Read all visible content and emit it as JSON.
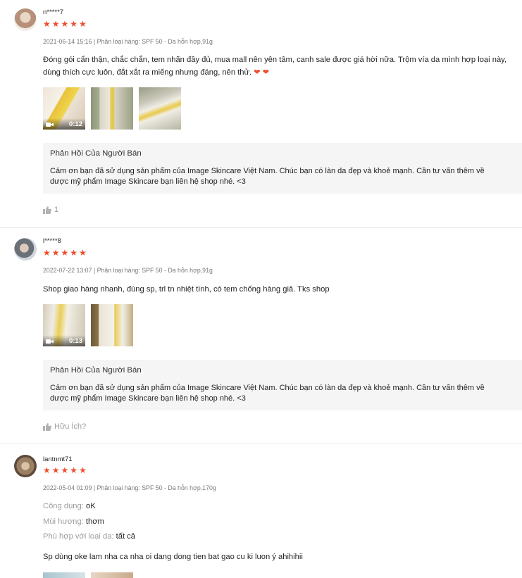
{
  "reviews": [
    {
      "username": "n*****7",
      "stars": [
        "★",
        "★",
        "★",
        "★",
        "★"
      ],
      "meta": "2021-06-14 15:16 | Phân loại hàng: SPF 50 - Da hỗn hợp,91g",
      "content_line1": "Đóng gói cẩn thận, chắc chắn, tem nhãn đầy đủ, mua mall nên yên tâm, canh sale được giá hời nữa. Trộm vía da mình hợp loại này,",
      "content_line2": "dùng thích cực luôn, đắt xắt ra miếng nhưng đáng, nên thử.",
      "hearts": "❤ ❤",
      "video_duration": "0:12",
      "reply_title": "Phản Hồi Của Người Bán",
      "reply_line1": "Cảm ơn bạn đã sử dụng sản phẩm của Image Skincare Việt Nam. Chúc bạn có làn da đẹp và khoẻ mạnh. Cần tư vấn thêm về",
      "reply_line2": "dược mỹ phẩm Image Skincare bạn liên hệ shop nhé. <3",
      "like_label": "1"
    },
    {
      "username": "l*****8",
      "stars": [
        "★",
        "★",
        "★",
        "★",
        "★"
      ],
      "meta": "2022-07-22 13:07 | Phân loại hàng: SPF 50 - Da hỗn hợp,91g",
      "content_line1": "Shop giao hàng nhanh, đúng sp, trl tn nhiệt tình, có tem chống hàng giả.  Tks shop",
      "video_duration": "0:13",
      "reply_title": "Phản Hồi Của Người Bán",
      "reply_line1": "Cảm ơn bạn đã sử dụng sản phẩm của Image Skincare Việt Nam. Chúc bạn có làn da đẹp và khoẻ mạnh. Cần tư vấn thêm về",
      "reply_line2": "dược mỹ phẩm Image Skincare bạn liên hệ shop nhé. <3",
      "like_label": "Hữu Ích?"
    },
    {
      "username": "lantnmt71",
      "stars": [
        "★",
        "★",
        "★",
        "★",
        "★"
      ],
      "meta": "2022-05-04 01:09 | Phân loại hàng: SPF 50 - Da hỗn hợp,170g",
      "attrs": [
        {
          "key": "Công dụng:",
          "value": "oK"
        },
        {
          "key": "Mùi hương:",
          "value": "thơm"
        },
        {
          "key": "Phù hợp với loại da:",
          "value": "tất cả"
        }
      ],
      "content_line1": "Sp dùng oke lam nha ca nha oi dang dong tien bat gao cu ki luon ý ahihihii"
    }
  ],
  "colors": {
    "accent": "#ee4d2d",
    "reply_bg": "#f5f5f5"
  },
  "icons": [
    "camera-icon",
    "thumbs-up-icon",
    "star-icon",
    "heart-icon"
  ]
}
